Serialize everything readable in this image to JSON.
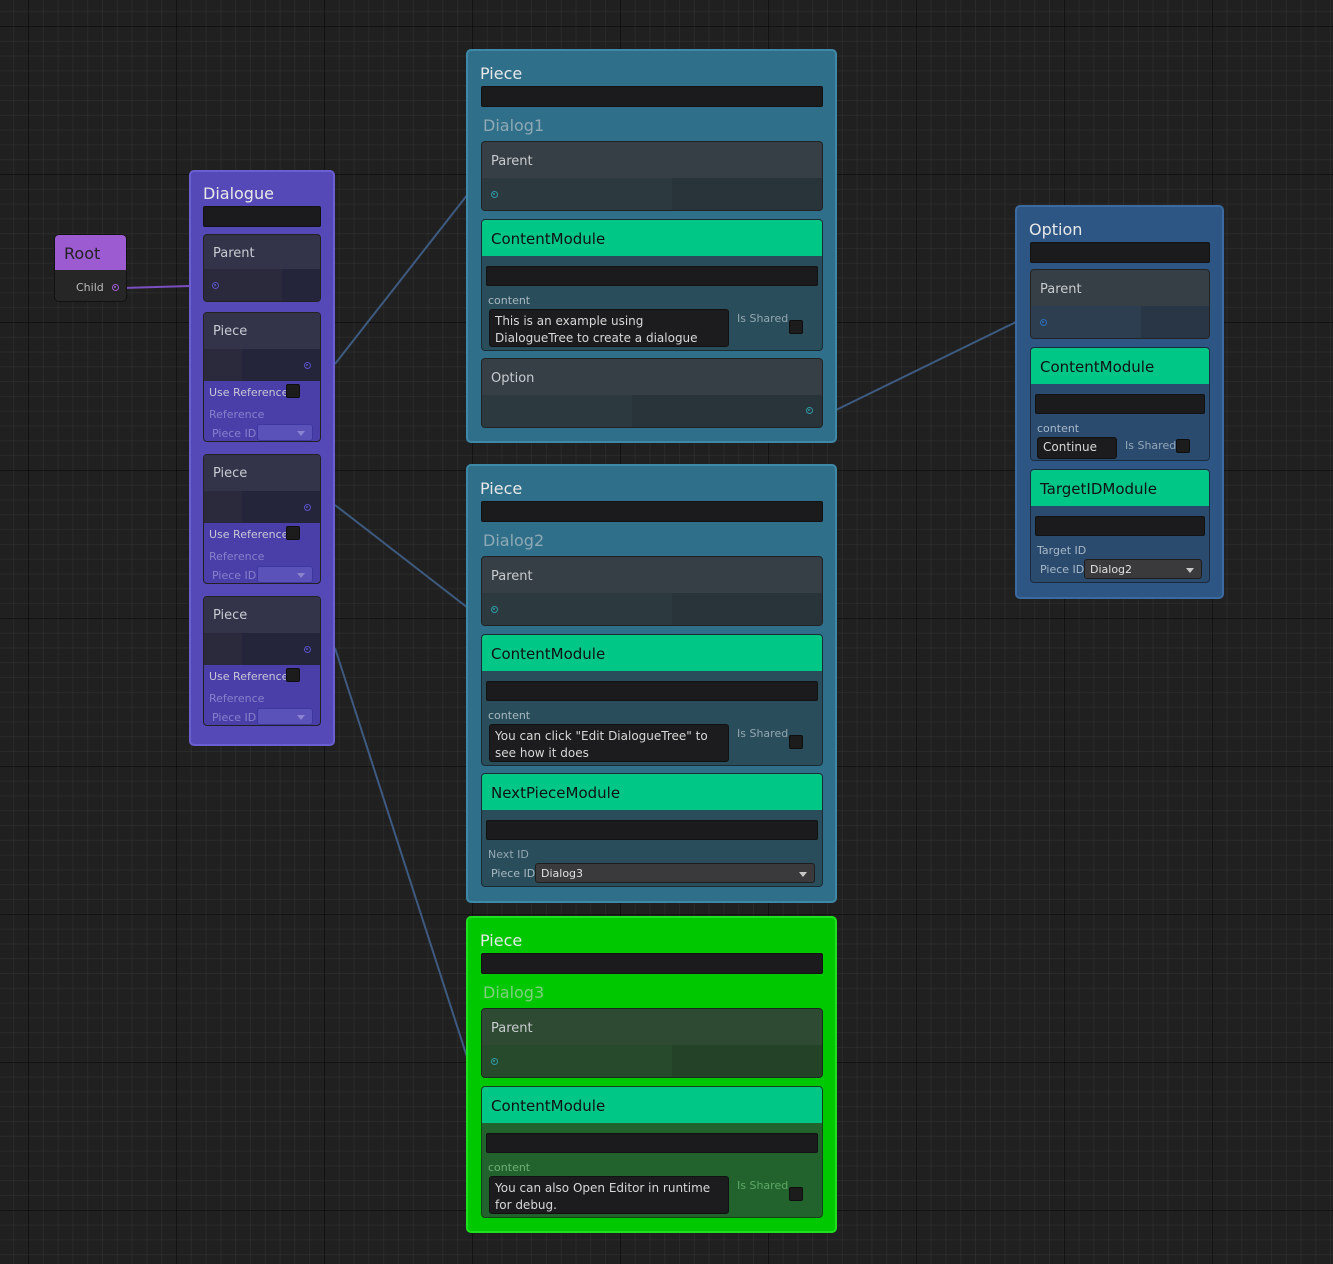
{
  "root_node": {
    "title": "Root",
    "child_label": "Child"
  },
  "dialogue_node": {
    "title": "Dialogue",
    "parent_label": "Parent",
    "pieces": [
      {
        "label": "Piece",
        "use_reference": "Use Reference",
        "reference": "Reference",
        "piece_id": "Piece ID"
      },
      {
        "label": "Piece",
        "use_reference": "Use Reference",
        "reference": "Reference",
        "piece_id": "Piece ID"
      },
      {
        "label": "Piece",
        "use_reference": "Use Reference",
        "reference": "Reference",
        "piece_id": "Piece ID"
      }
    ]
  },
  "piece1": {
    "title": "Piece",
    "name": "Dialog1",
    "parent_label": "Parent",
    "content_module": {
      "title": "ContentModule",
      "content_label": "content",
      "text": "This is an example using DialogueTree to create a dialogue",
      "shared_label": "Is Shared"
    },
    "option_label": "Option"
  },
  "piece2": {
    "title": "Piece",
    "name": "Dialog2",
    "parent_label": "Parent",
    "content_module": {
      "title": "ContentModule",
      "content_label": "content",
      "text": "You can click \"Edit DialogueTree\" to see how it does",
      "shared_label": "Is Shared"
    },
    "next_module": {
      "title": "NextPieceModule",
      "next_label": "Next ID",
      "piece_id_label": "Piece ID",
      "value": "Dialog3"
    }
  },
  "piece3": {
    "title": "Piece",
    "name": "Dialog3",
    "parent_label": "Parent",
    "content_module": {
      "title": "ContentModule",
      "content_label": "content",
      "text": "You can also Open Editor in runtime for debug.",
      "shared_label": "Is Shared"
    }
  },
  "option_node": {
    "title": "Option",
    "parent_label": "Parent",
    "content_module": {
      "title": "ContentModule",
      "content_label": "content",
      "text": "Continue",
      "shared_label": "Is Shared"
    },
    "target_module": {
      "title": "TargetIDModule",
      "target_label": "Target ID",
      "piece_id_label": "Piece ID",
      "value": "Dialog2"
    }
  },
  "colors": {
    "canvas": "#202020",
    "root": "#9d5bd2",
    "dialogue": "#5549b8",
    "piece": "#2f6f8a",
    "piece_selected": "#00c800",
    "option": "#2d5684",
    "module": "#00c786",
    "wire_blue": "#3d5a80",
    "wire_purple": "#7b4fc0"
  }
}
